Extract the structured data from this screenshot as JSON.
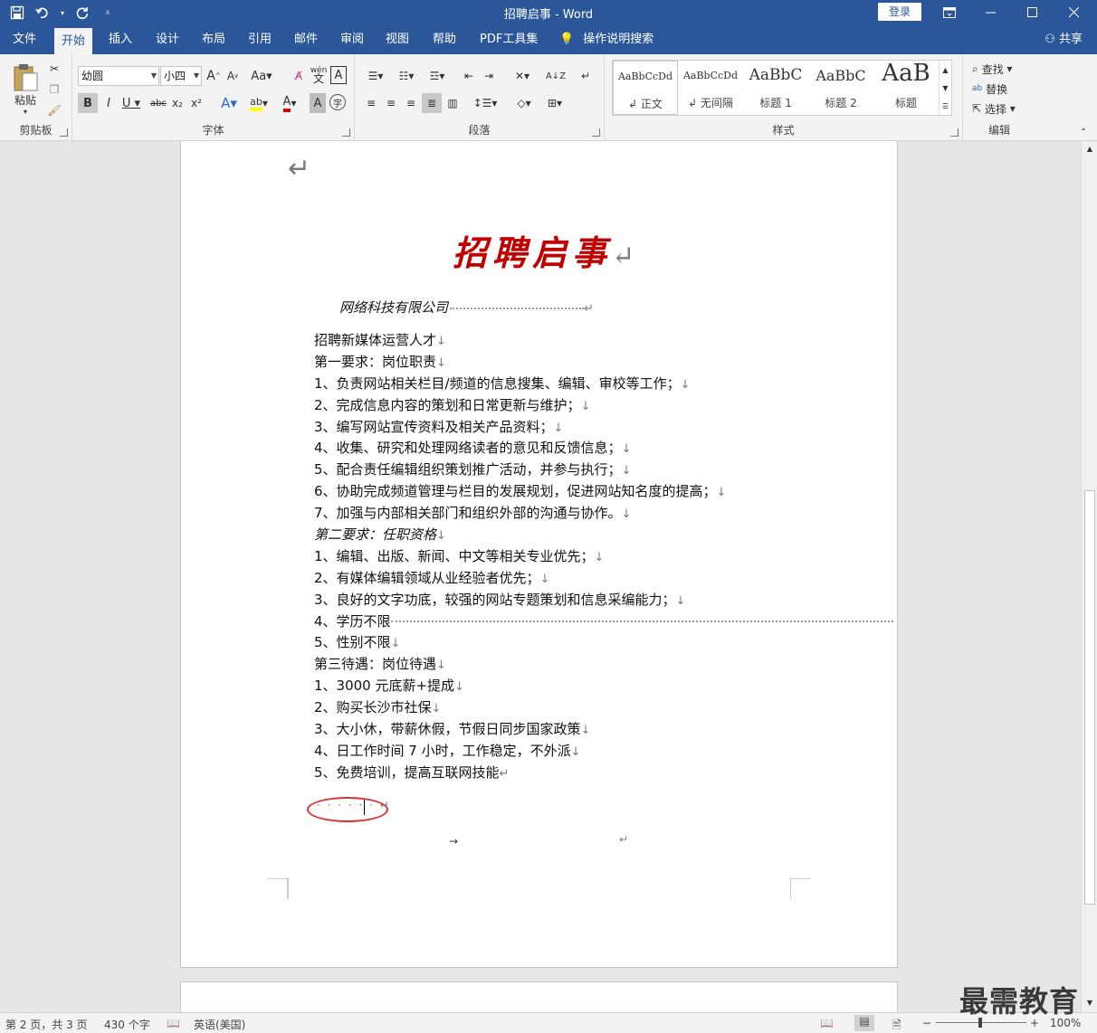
{
  "window": {
    "title": "招聘启事 - Word",
    "login_label": "登录",
    "share_label": "共享"
  },
  "tabs": [
    "文件",
    "开始",
    "插入",
    "设计",
    "布局",
    "引用",
    "邮件",
    "审阅",
    "视图",
    "帮助",
    "PDF工具集",
    "操作说明搜索"
  ],
  "active_tab": "开始",
  "ribbon": {
    "clipboard": {
      "paste_label": "粘贴",
      "group_label": "剪贴板"
    },
    "font": {
      "font_name": "幼圆",
      "font_size": "小四",
      "group_label": "字体"
    },
    "paragraph": {
      "group_label": "段落"
    },
    "styles": {
      "group_label": "样式",
      "items": [
        {
          "sample": "AaBbCcDd",
          "name": "正文"
        },
        {
          "sample": "AaBbCcDd",
          "name": "无间隔"
        },
        {
          "sample": "AaBbC",
          "name": "标题 1"
        },
        {
          "sample": "AaBbC",
          "name": "标题 2"
        },
        {
          "sample": "AaB",
          "name": "标题"
        }
      ]
    },
    "editing": {
      "find": "查找",
      "replace": "替换",
      "select": "选择",
      "group_label": "编辑"
    }
  },
  "document": {
    "heading": "招聘启事",
    "company": "网络科技有限公司",
    "lines": [
      {
        "text": "招聘新媒体运营人才",
        "mark": "↓"
      },
      {
        "text": "第一要求：岗位职责",
        "mark": "↓"
      },
      {
        "text": "1、负责网站相关栏目/频道的信息搜集、编辑、审校等工作；",
        "mark": "↓"
      },
      {
        "text": "2、完成信息内容的策划和日常更新与维护；",
        "mark": "↓"
      },
      {
        "text": "3、编写网站宣传资料及相关产品资料；",
        "mark": "↓"
      },
      {
        "text": "4、收集、研究和处理网络读者的意见和反馈信息；",
        "mark": "↓"
      },
      {
        "text": "5、配合责任编辑组织策划推广活动，并参与执行；",
        "mark": "↓"
      },
      {
        "text": "6、协助完成频道管理与栏目的发展规划，促进网站知名度的提高；",
        "mark": "↓"
      },
      {
        "text": "7、加强与内部相关部门和组织外部的沟通与协作。",
        "mark": "↓"
      },
      {
        "text": "第二要求：任职资格",
        "mark": "↓",
        "italic": true
      },
      {
        "text": "1、编辑、出版、新闻、中文等相关专业优先；",
        "mark": "↓"
      },
      {
        "text": "2、有媒体编辑领域从业经验者优先；",
        "mark": "↓"
      },
      {
        "text": "3、良好的文字功底，较强的网站专题策划和信息采编能力；",
        "mark": "↓"
      },
      {
        "text": "4、学历不限",
        "mark": "",
        "dotted": true
      },
      {
        "text": "5、性别不限",
        "mark": "↓"
      },
      {
        "text": "第三待遇：岗位待遇",
        "mark": "↓"
      },
      {
        "text": "1、3000 元底薪+提成",
        "mark": "↓"
      },
      {
        "text": "2、购买长沙市社保",
        "mark": "↓"
      },
      {
        "text": "3、大小休，带薪休假，节假日同步国家政策",
        "mark": "↓"
      },
      {
        "text": "4、日工作时间 7 小时，工作稳定，不外派",
        "mark": "↓"
      },
      {
        "text": "5、免费培训，提高互联网技能",
        "mark": "↵"
      }
    ]
  },
  "statusbar": {
    "page": "第 2 页，共 3 页",
    "words": "430 个字",
    "language": "英语(美国)",
    "zoom": "100%"
  },
  "watermark": "最需教育",
  "colors": {
    "titlebar": "#2b579a",
    "heading": "#c00000",
    "annotation": "#e03030"
  }
}
